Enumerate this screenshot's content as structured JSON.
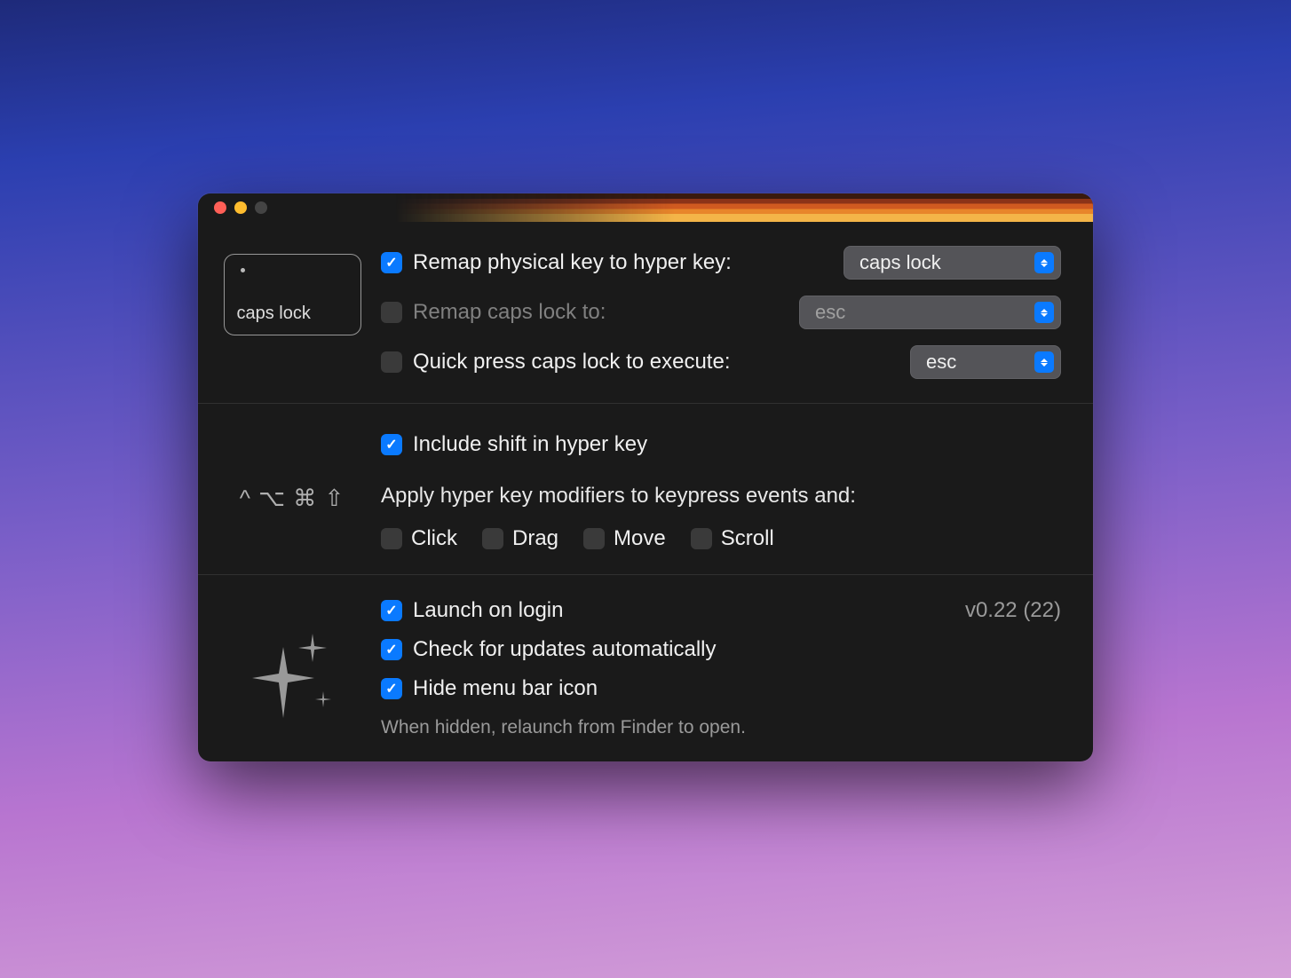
{
  "keycap_label": "caps lock",
  "modifier_symbols": "^ ⌥ ⌘ ⇧",
  "section1": {
    "remap_hyper": {
      "checked": true,
      "label": "Remap physical key to hyper key:",
      "select_value": "caps lock"
    },
    "remap_capslock": {
      "checked": false,
      "label": "Remap caps lock to:",
      "select_value": "esc"
    },
    "quick_press": {
      "checked": false,
      "label": "Quick press caps lock to execute:",
      "select_value": "esc"
    }
  },
  "section2": {
    "include_shift": {
      "checked": true,
      "label": "Include shift in hyper key"
    },
    "apply_modifiers_label": "Apply hyper key modifiers to keypress events and:",
    "click": {
      "checked": false,
      "label": "Click"
    },
    "drag": {
      "checked": false,
      "label": "Drag"
    },
    "move": {
      "checked": false,
      "label": "Move"
    },
    "scroll": {
      "checked": false,
      "label": "Scroll"
    }
  },
  "section3": {
    "launch_login": {
      "checked": true,
      "label": "Launch on login"
    },
    "check_updates": {
      "checked": true,
      "label": "Check for updates automatically"
    },
    "hide_menubar": {
      "checked": true,
      "label": "Hide menu bar icon"
    },
    "version": "v0.22 (22)",
    "note": "When hidden, relaunch from Finder to open."
  }
}
